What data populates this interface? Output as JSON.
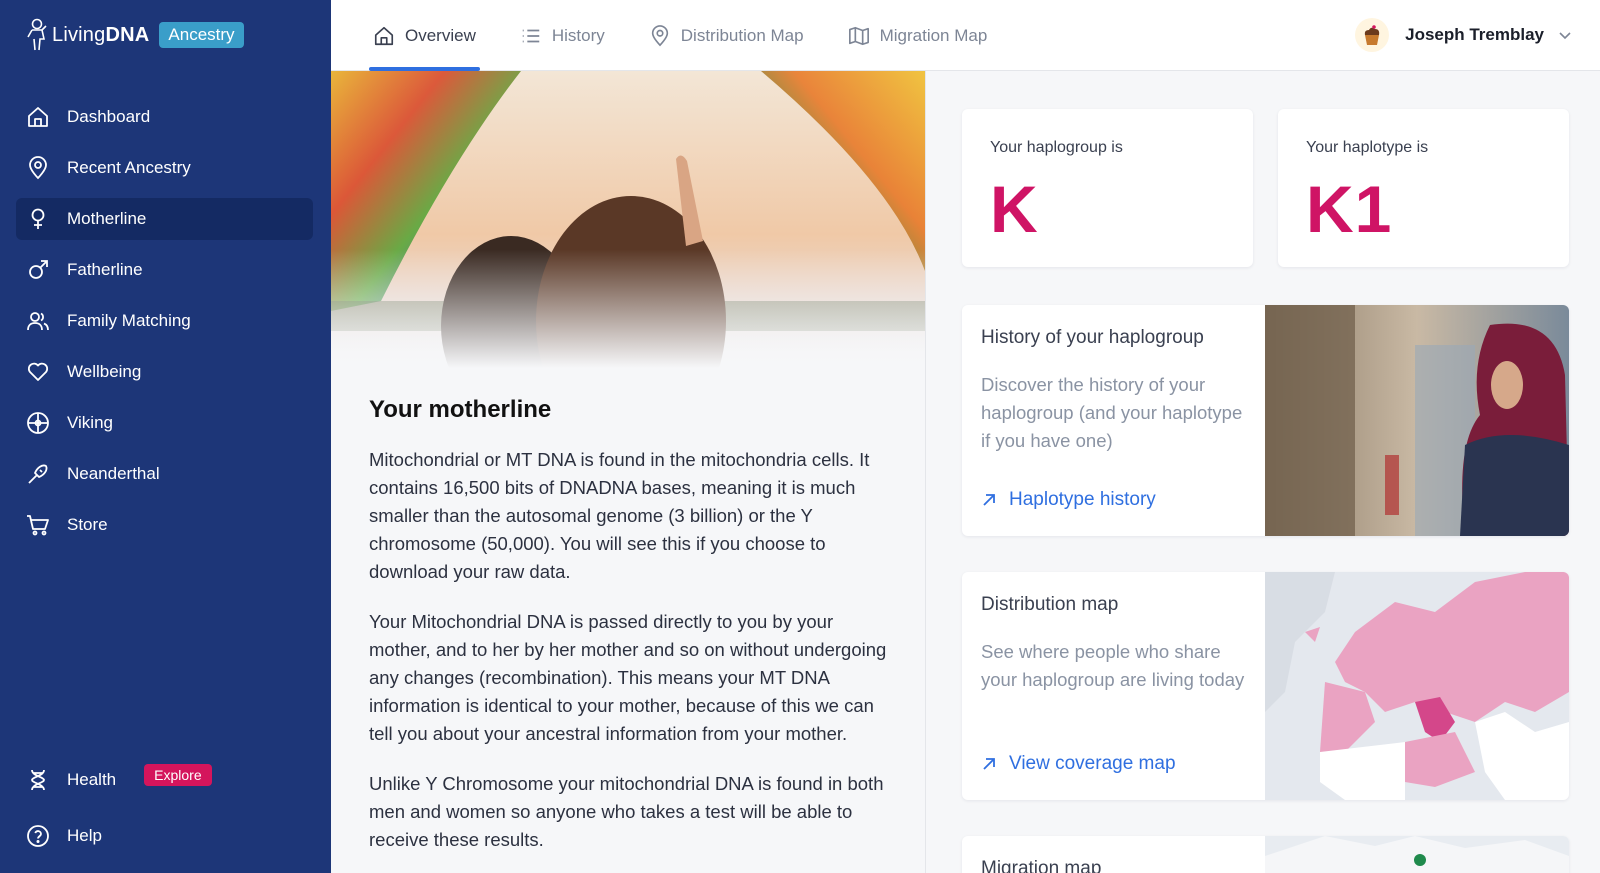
{
  "brand": {
    "name_light": "Living",
    "name_bold": "DNA",
    "badge": "Ancestry"
  },
  "sidebar": {
    "items": [
      {
        "label": "Dashboard",
        "icon": "home-icon"
      },
      {
        "label": "Recent Ancestry",
        "icon": "map-pin-icon"
      },
      {
        "label": "Motherline",
        "icon": "female-symbol-icon",
        "active": true
      },
      {
        "label": "Fatherline",
        "icon": "male-symbol-icon"
      },
      {
        "label": "Family Matching",
        "icon": "users-icon"
      },
      {
        "label": "Wellbeing",
        "icon": "heart-icon"
      },
      {
        "label": "Viking",
        "icon": "viking-shield-icon"
      },
      {
        "label": "Neanderthal",
        "icon": "club-icon"
      },
      {
        "label": "Store",
        "icon": "cart-icon"
      }
    ],
    "health": {
      "label": "Health",
      "badge": "Explore",
      "icon": "dna-icon"
    },
    "help": {
      "label": "Help",
      "icon": "help-circle-icon"
    }
  },
  "tabs": [
    {
      "label": "Overview",
      "icon": "home-icon",
      "active": true
    },
    {
      "label": "History",
      "icon": "list-icon"
    },
    {
      "label": "Distribution Map",
      "icon": "map-pin-icon"
    },
    {
      "label": "Migration Map",
      "icon": "map-icon"
    }
  ],
  "user": {
    "name": "Joseph Tremblay"
  },
  "motherline": {
    "title": "Your motherline",
    "paragraphs": [
      "Mitochondrial or MT DNA is found in the mitochondria cells. It contains 16,500 bits of DNADNA bases, meaning it is much smaller than the autosomal genome (3 billion) or the Y chromosome (50,000). You will see this if you choose to download your raw data.",
      "Your Mitochondrial DNA is passed directly to you by your mother, and to her by her mother and so on without undergoing any changes (recombination). This means your MT DNA information is identical to your mother, because of this we can tell you about your ancestral information from your mother.",
      "Unlike Y Chromosome your mitochondrial DNA is found in both men and women so anyone who takes a test will be able to receive these results."
    ]
  },
  "haplogroup": {
    "label": "Your haplogroup is",
    "value": "K"
  },
  "haplotype": {
    "label": "Your haplotype is",
    "value": "K1"
  },
  "history_card": {
    "title": "History of your haplogroup",
    "description": "Discover the history of your haplogroup (and your haplotype if you have one)",
    "link": "Haplotype history"
  },
  "distribution_card": {
    "title": "Distribution map",
    "description": "See where people who share your haplogroup are living today",
    "link": "View coverage map"
  },
  "migration_card": {
    "title": "Migration map"
  },
  "colors": {
    "sidebar": "#1d3678",
    "accent": "#cf1465",
    "link": "#2f6fe0",
    "badge_blue": "#3a9ec9"
  }
}
